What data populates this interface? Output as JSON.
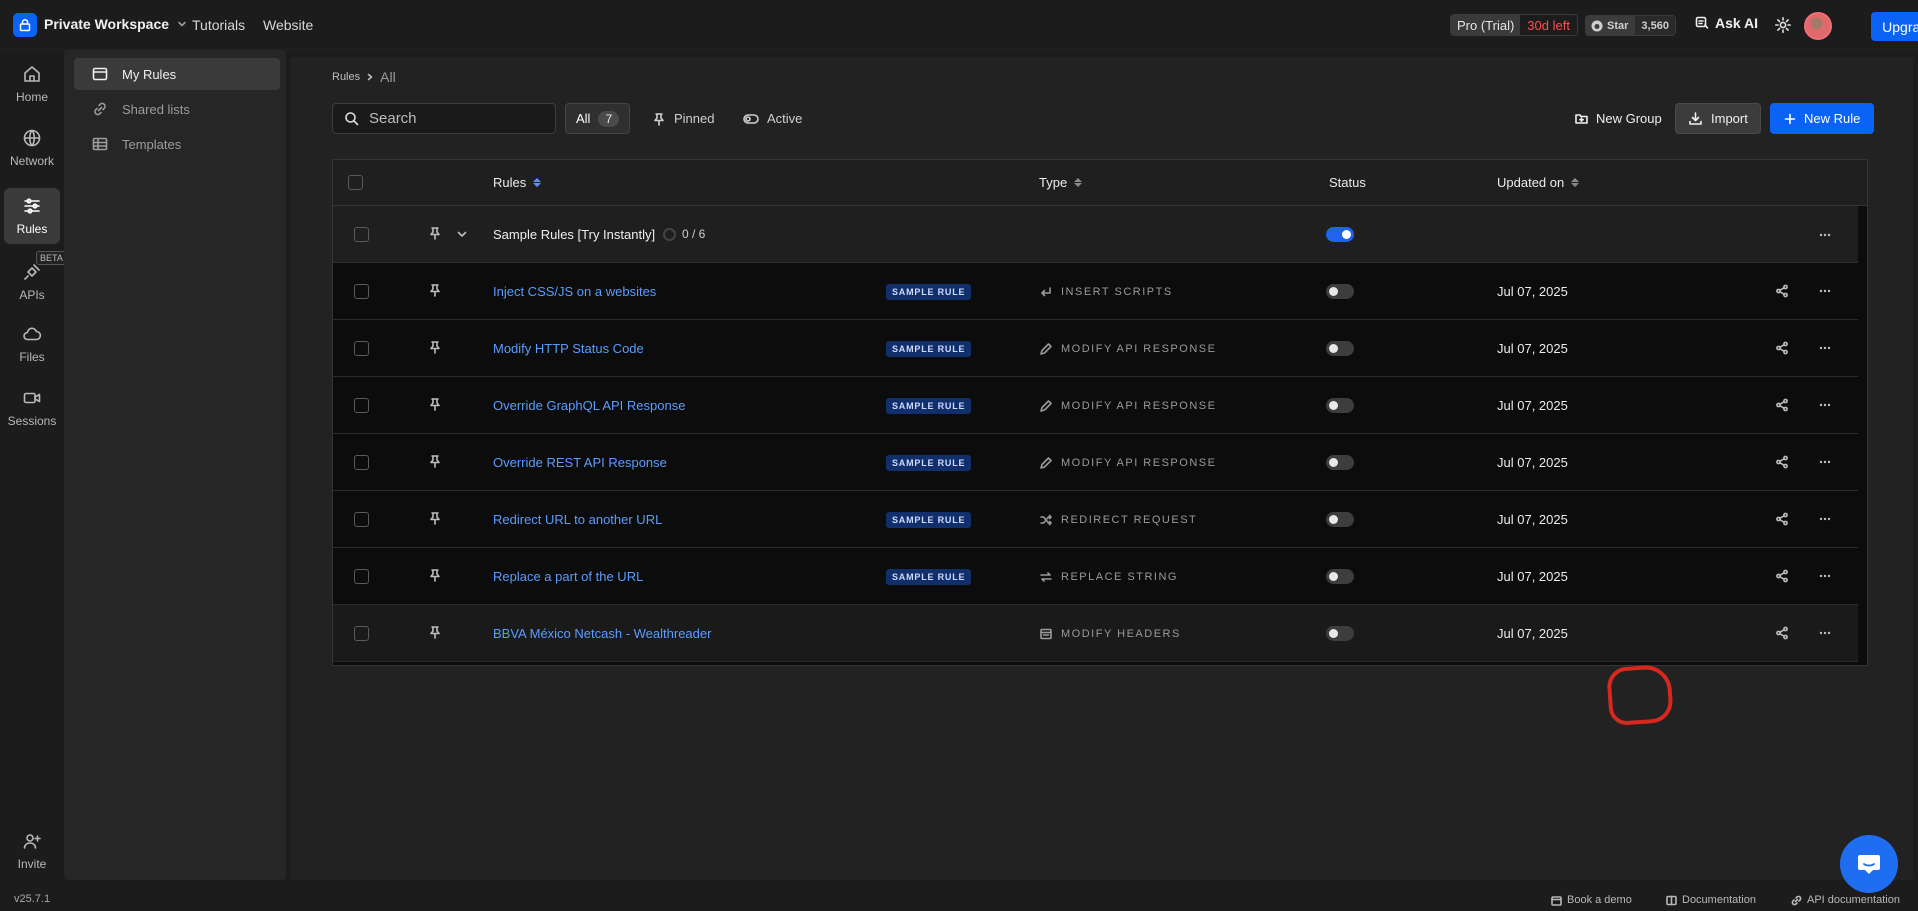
{
  "topbar": {
    "workspace": "Private Workspace",
    "tutorials": "Tutorials",
    "website": "Website",
    "plan_label": "Pro (Trial)",
    "plan_days": "30d left",
    "github_star": "Star",
    "github_count": "3,560",
    "ask_ai": "Ask AI",
    "upgrade": "Upgrade"
  },
  "rail": {
    "home": "Home",
    "network": "Network",
    "rules": "Rules",
    "apis": "APIs",
    "beta": "BETA",
    "files": "Files",
    "sessions": "Sessions",
    "invite": "Invite",
    "version": "v25.7.1"
  },
  "sidebar": {
    "items": [
      {
        "label": "My Rules",
        "icon": "rules-list-icon",
        "active": true
      },
      {
        "label": "Shared lists",
        "icon": "link-icon",
        "active": false
      },
      {
        "label": "Templates",
        "icon": "table-icon",
        "active": false
      }
    ]
  },
  "main": {
    "breadcrumb_root": "Rules",
    "breadcrumb_current": "All",
    "search_placeholder": "Search",
    "filter_all": "All",
    "filter_all_count": "7",
    "filter_pinned": "Pinned",
    "filter_active": "Active",
    "new_group": "New Group",
    "import": "Import",
    "new_rule": "New Rule"
  },
  "table": {
    "headers": {
      "rules": "Rules",
      "type": "Type",
      "status": "Status",
      "updated": "Updated on"
    },
    "group": {
      "name": "Sample Rules [Try Instantly]",
      "progress": "0 / 6",
      "enabled": true
    },
    "badge_label": "SAMPLE RULE",
    "rows": [
      {
        "name": "Inject CSS/JS on a websites",
        "type": "INSERT SCRIPTS",
        "type_icon": "return-arrow-icon",
        "date": "Jul 07, 2025",
        "sample": true,
        "enabled": false
      },
      {
        "name": "Modify HTTP Status Code",
        "type": "MODIFY API RESPONSE",
        "type_icon": "pencil-icon",
        "date": "Jul 07, 2025",
        "sample": true,
        "enabled": false
      },
      {
        "name": "Override GraphQL API Response",
        "type": "MODIFY API RESPONSE",
        "type_icon": "pencil-icon",
        "date": "Jul 07, 2025",
        "sample": true,
        "enabled": false
      },
      {
        "name": "Override REST API Response",
        "type": "MODIFY API RESPONSE",
        "type_icon": "pencil-icon",
        "date": "Jul 07, 2025",
        "sample": true,
        "enabled": false
      },
      {
        "name": "Redirect URL to another URL",
        "type": "REDIRECT REQUEST",
        "type_icon": "shuffle-icon",
        "date": "Jul 07, 2025",
        "sample": true,
        "enabled": false
      },
      {
        "name": "Replace a part of the URL",
        "type": "REPLACE STRING",
        "type_icon": "swap-icon",
        "date": "Jul 07, 2025",
        "sample": true,
        "enabled": false
      },
      {
        "name": "BBVA México Netcash - Wealthreader",
        "type": "MODIFY HEADERS",
        "type_icon": "headers-icon",
        "date": "Jul 07, 2025",
        "sample": false,
        "enabled": false
      }
    ]
  },
  "footer": {
    "book_demo": "Book a demo",
    "documentation": "Documentation",
    "api_documentation": "API documentation"
  },
  "colors": {
    "accent": "#0b63f6",
    "link": "#5b9cff",
    "badge_bg": "#11306b",
    "trial_red": "#ff4d4f"
  }
}
